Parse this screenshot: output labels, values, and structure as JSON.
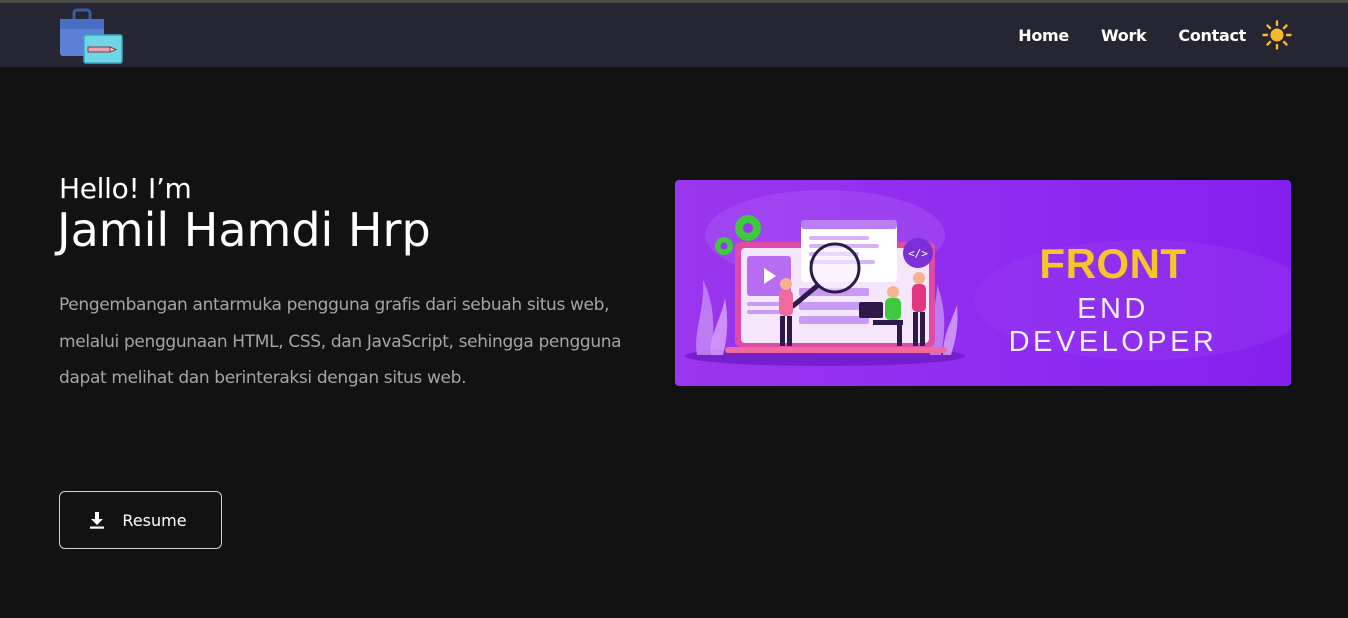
{
  "nav": {
    "links": [
      "Home",
      "Work",
      "Contact"
    ],
    "logo_icon": "briefcase-pencil-icon",
    "theme_icon": "sun-icon",
    "colors": {
      "bar": "#252631",
      "sun": "#f7b731"
    }
  },
  "hero": {
    "greeting": "Hello! I’m",
    "name": "Jamil Hamdi Hrp",
    "description": "Pengembangan antarmuka pengguna grafis dari sebuah situs web, melalui penggunaan HTML, CSS, dan JavaScript, sehingga pengguna dapat melihat dan berinteraksi dengan situs web.",
    "resume_label": "Resume",
    "resume_icon": "download-icon"
  },
  "banner": {
    "title": "FRONT",
    "subtitle": "END DEVELOPER",
    "code_badge": "</>",
    "colors": {
      "background": "#8d2bf0",
      "title": "#f6c628"
    }
  }
}
